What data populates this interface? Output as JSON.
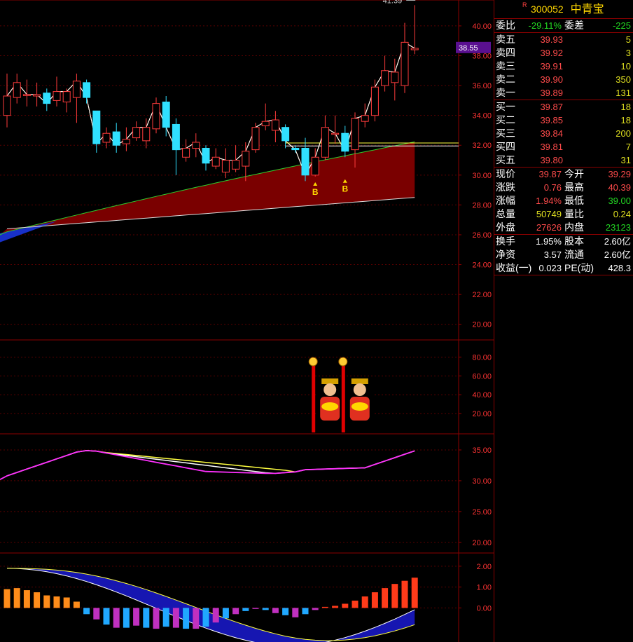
{
  "quote": {
    "flag": "R",
    "code": "300052",
    "name": "中青宝",
    "weibi_label": "委比",
    "weibi": "-29.11%",
    "weicha_label": "委差",
    "weicha": "-225",
    "asks": [
      {
        "label": "卖五",
        "price": "39.93",
        "vol": "5"
      },
      {
        "label": "卖四",
        "price": "39.92",
        "vol": "3"
      },
      {
        "label": "卖三",
        "price": "39.91",
        "vol": "10"
      },
      {
        "label": "卖二",
        "price": "39.90",
        "vol": "350"
      },
      {
        "label": "卖一",
        "price": "39.89",
        "vol": "131"
      }
    ],
    "bids": [
      {
        "label": "买一",
        "price": "39.87",
        "vol": "18"
      },
      {
        "label": "买二",
        "price": "39.85",
        "vol": "18"
      },
      {
        "label": "买三",
        "price": "39.84",
        "vol": "200"
      },
      {
        "label": "买四",
        "price": "39.81",
        "vol": "7"
      },
      {
        "label": "买五",
        "price": "39.80",
        "vol": "31"
      }
    ],
    "stats": [
      {
        "l1": "现价",
        "v1": "39.87",
        "l2": "今开",
        "v2": "39.29"
      },
      {
        "l1": "涨跌",
        "v1": "0.76",
        "l2": "最高",
        "v2": "40.39"
      },
      {
        "l1": "涨幅",
        "v1": "1.94%",
        "l2": "最低",
        "v2": "39.00"
      },
      {
        "l1": "总量",
        "v1": "50749",
        "l2": "量比",
        "v2": "0.24"
      },
      {
        "l1": "外盘",
        "v1": "27626",
        "l2": "内盘",
        "v2": "23123"
      }
    ],
    "extra": [
      {
        "l1": "换手",
        "v1": "1.95%",
        "l2": "股本",
        "v2": "2.60亿"
      },
      {
        "l1": "净资",
        "v1": "3.57",
        "l2": "流通",
        "v2": "2.60亿"
      },
      {
        "l1": "收益(一)",
        "v1": "0.023",
        "l2": "PE(动)",
        "v2": "428.3"
      }
    ]
  },
  "chart_data": [
    {
      "type": "candlestick",
      "panel": "price",
      "ylim": [
        19,
        41.5
      ],
      "yticks": [
        "40.00",
        "38.00",
        "36.00",
        "34.00",
        "32.00",
        "30.00",
        "28.00",
        "26.00",
        "24.00",
        "22.00",
        "20.00"
      ],
      "current_price_tag": "38.55",
      "high_annotation": "41.39",
      "buy_markers": [
        "B",
        "B"
      ],
      "candles": [
        {
          "o": 34.0,
          "c": 35.3,
          "h": 36.8,
          "l": 33.2
        },
        {
          "o": 35.2,
          "c": 36.2,
          "h": 36.8,
          "l": 34.8
        },
        {
          "o": 35.4,
          "c": 35.4,
          "h": 36.4,
          "l": 34.6
        },
        {
          "o": 35.3,
          "c": 35.4,
          "h": 36.2,
          "l": 34.6
        },
        {
          "o": 35.5,
          "c": 34.8,
          "h": 35.8,
          "l": 34.3
        },
        {
          "o": 35.0,
          "c": 35.6,
          "h": 36.6,
          "l": 34.6
        },
        {
          "o": 34.9,
          "c": 35.6,
          "h": 35.8,
          "l": 34.2
        },
        {
          "o": 35.2,
          "c": 36.3,
          "h": 36.8,
          "l": 33.5
        },
        {
          "o": 36.2,
          "c": 35.2,
          "h": 36.4,
          "l": 34.8
        },
        {
          "o": 34.3,
          "c": 32.1,
          "h": 34.3,
          "l": 31.5
        },
        {
          "o": 32.2,
          "c": 32.8,
          "h": 33.2,
          "l": 31.8
        },
        {
          "o": 32.9,
          "c": 32.0,
          "h": 33.5,
          "l": 31.5
        },
        {
          "o": 32.1,
          "c": 32.4,
          "h": 33.2,
          "l": 31.6
        },
        {
          "o": 32.5,
          "c": 33.2,
          "h": 33.6,
          "l": 32.3
        },
        {
          "o": 32.3,
          "c": 33.2,
          "h": 33.8,
          "l": 31.8
        },
        {
          "o": 33.1,
          "c": 34.8,
          "h": 35.2,
          "l": 32.8
        },
        {
          "o": 34.9,
          "c": 33.2,
          "h": 35.3,
          "l": 32.6
        },
        {
          "o": 33.4,
          "c": 31.7,
          "h": 33.8,
          "l": 30.0
        },
        {
          "o": 31.2,
          "c": 31.8,
          "h": 32.4,
          "l": 30.9
        },
        {
          "o": 31.8,
          "c": 32.2,
          "h": 32.8,
          "l": 31.2
        },
        {
          "o": 31.8,
          "c": 30.8,
          "h": 32.0,
          "l": 30.3
        },
        {
          "o": 30.6,
          "c": 31.2,
          "h": 31.8,
          "l": 30.4
        },
        {
          "o": 30.2,
          "c": 31.0,
          "h": 31.8,
          "l": 29.8
        },
        {
          "o": 30.4,
          "c": 31.0,
          "h": 32.0,
          "l": 30.2
        },
        {
          "o": 30.6,
          "c": 31.6,
          "h": 32.2,
          "l": 29.6
        },
        {
          "o": 31.7,
          "c": 33.2,
          "h": 33.5,
          "l": 31.5
        },
        {
          "o": 33.3,
          "c": 33.6,
          "h": 34.8,
          "l": 33.0
        },
        {
          "o": 33.0,
          "c": 33.7,
          "h": 34.3,
          "l": 32.2
        },
        {
          "o": 33.2,
          "c": 32.3,
          "h": 33.4,
          "l": 31.8
        },
        {
          "o": 31.8,
          "c": 31.7,
          "h": 32.0,
          "l": 31.5
        },
        {
          "o": 31.8,
          "c": 30.0,
          "h": 32.5,
          "l": 29.6
        },
        {
          "o": 30.0,
          "c": 31.2,
          "h": 31.8,
          "l": 29.9
        },
        {
          "o": 31.2,
          "c": 33.2,
          "h": 34.0,
          "l": 31.0
        },
        {
          "o": 32.8,
          "c": 32.8,
          "h": 34.0,
          "l": 32.1
        },
        {
          "o": 32.8,
          "c": 31.6,
          "h": 33.3,
          "l": 31.2
        },
        {
          "o": 31.7,
          "c": 33.8,
          "h": 34.2,
          "l": 30.5
        },
        {
          "o": 33.6,
          "c": 34.0,
          "h": 34.8,
          "l": 33.2
        },
        {
          "o": 34.0,
          "c": 35.9,
          "h": 36.4,
          "l": 33.6
        },
        {
          "o": 36.0,
          "c": 37.0,
          "h": 38.0,
          "l": 35.6
        },
        {
          "o": 36.2,
          "c": 36.9,
          "h": 37.8,
          "l": 35.0
        },
        {
          "o": 36.0,
          "c": 38.9,
          "h": 40.2,
          "l": 35.5
        },
        {
          "o": 38.4,
          "c": 38.5,
          "h": 41.39,
          "l": 38.1
        }
      ]
    },
    {
      "type": "bar",
      "panel": "signal",
      "yticks": [
        "80.00",
        "60.00",
        "40.00",
        "20.00"
      ],
      "ylim": [
        0,
        90
      ],
      "signals_at_candle_index": [
        31,
        34
      ]
    },
    {
      "type": "line",
      "panel": "oscillator",
      "yticks": [
        "35.00",
        "30.00",
        "25.00",
        "20.00"
      ],
      "ylim": [
        18.5,
        37.5
      ]
    },
    {
      "type": "bar",
      "panel": "macd",
      "yticks": [
        "2.00",
        "1.00",
        "0.00"
      ],
      "ylim": [
        -1.5,
        2.6
      ],
      "values": [
        0.9,
        0.95,
        0.85,
        0.75,
        0.6,
        0.55,
        0.5,
        0.3,
        -0.3,
        -0.55,
        -0.8,
        -0.95,
        -0.95,
        -0.85,
        -0.95,
        -1.0,
        -0.9,
        -0.95,
        -1.0,
        -1.0,
        -0.9,
        -0.7,
        -0.5,
        -0.3,
        -0.15,
        -0.05,
        -0.1,
        -0.25,
        -0.35,
        -0.45,
        -0.3,
        -0.1,
        0.05,
        0.1,
        0.2,
        0.35,
        0.55,
        0.75,
        0.95,
        1.15,
        1.3,
        1.45
      ]
    }
  ]
}
